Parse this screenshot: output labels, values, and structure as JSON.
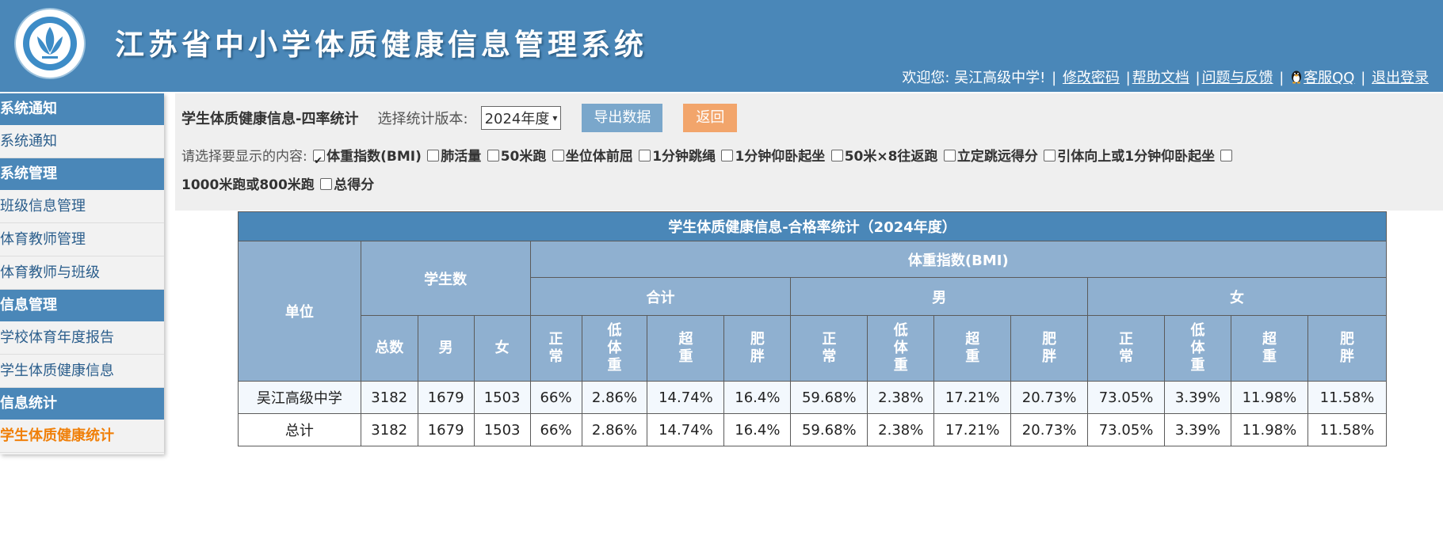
{
  "header": {
    "title": "江苏省中小学体质健康信息管理系统",
    "welcome": "欢迎您: 吴江高级中学!",
    "links": {
      "change_password": "修改密码",
      "help_doc": "帮助文档",
      "feedback": "问题与反馈",
      "service_qq": "客服QQ",
      "logout": "退出登录"
    }
  },
  "sidebar": {
    "groups": [
      {
        "title": "系统通知",
        "items": [
          "系统通知"
        ]
      },
      {
        "title": "系统管理",
        "items": [
          "班级信息管理",
          "体育教师管理",
          "体育教师与班级"
        ]
      },
      {
        "title": "信息管理",
        "items": [
          "学校体育年度报告",
          "学生体质健康信息"
        ]
      },
      {
        "title": "信息统计",
        "items": [
          "学生体质健康统计"
        ]
      }
    ],
    "active_item": "学生体质健康统计"
  },
  "toolbar": {
    "title": "学生体质健康信息-四率统计",
    "version_label": "选择统计版本:",
    "version_value": "2024年度",
    "export_label": "导出数据",
    "back_label": "返回",
    "display_label": "请选择要显示的内容:",
    "options": [
      {
        "label": "体重指数(BMI)",
        "checked": true
      },
      {
        "label": "肺活量",
        "checked": false
      },
      {
        "label": "50米跑",
        "checked": false
      },
      {
        "label": "坐位体前屈",
        "checked": false
      },
      {
        "label": "1分钟跳绳",
        "checked": false
      },
      {
        "label": "1分钟仰卧起坐",
        "checked": false
      },
      {
        "label": "50米×8往返跑",
        "checked": false
      },
      {
        "label": "立定跳远得分",
        "checked": false
      },
      {
        "label": "引体向上或1分钟仰卧起坐",
        "checked": false
      },
      {
        "label": "1000米跑或800米跑",
        "checked": false
      },
      {
        "label": "总得分",
        "checked": false
      }
    ]
  },
  "table": {
    "caption": "学生体质健康信息-合格率统计（2024年度）",
    "unit_header": "单位",
    "student_count_header": "学生数",
    "bmi_header": "体重指数(BMI)",
    "groups": {
      "total": "合计",
      "male": "男",
      "female": "女"
    },
    "count_cols": {
      "total": "总数",
      "male": "男",
      "female": "女"
    },
    "metric_cols": {
      "normal": "正常",
      "low": "低体重",
      "over": "超重",
      "obese": "肥胖"
    },
    "rows": [
      {
        "unit": "吴江高级中学",
        "values": [
          "3182",
          "1679",
          "1503",
          "66%",
          "2.86%",
          "14.74%",
          "16.4%",
          "59.68%",
          "2.38%",
          "17.21%",
          "20.73%",
          "73.05%",
          "3.39%",
          "11.98%",
          "11.58%"
        ]
      },
      {
        "unit": "总计",
        "values": [
          "3182",
          "1679",
          "1503",
          "66%",
          "2.86%",
          "14.74%",
          "16.4%",
          "59.68%",
          "2.38%",
          "17.21%",
          "20.73%",
          "73.05%",
          "3.39%",
          "11.98%",
          "11.58%"
        ]
      }
    ]
  }
}
